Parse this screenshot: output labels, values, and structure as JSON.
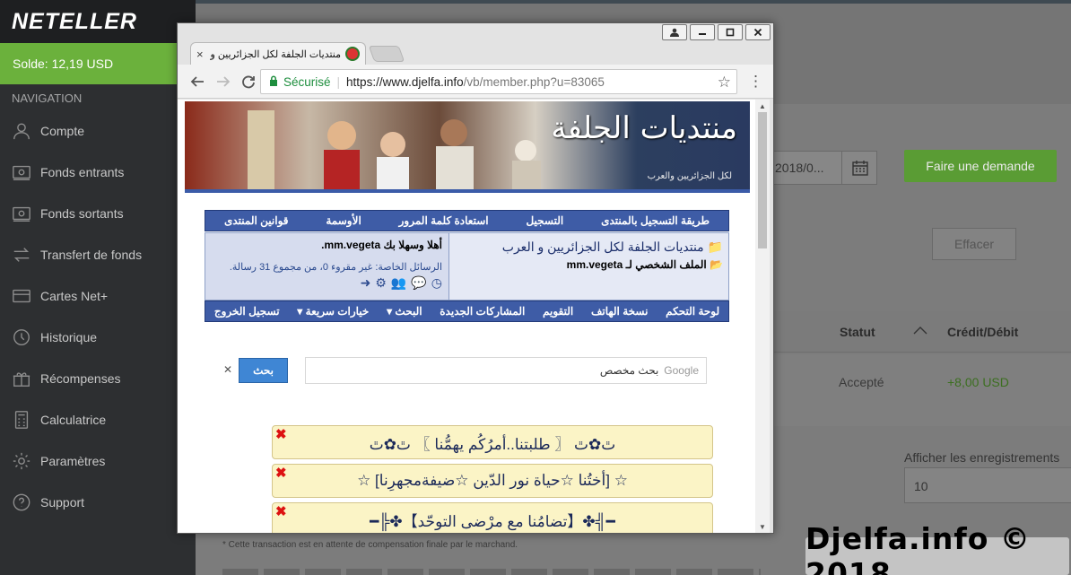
{
  "neteller": {
    "logo": "NETELLER",
    "balance": "Solde: 12,19 USD",
    "nav_title": "NAVIGATION",
    "nav_items": [
      {
        "label": "Compte",
        "icon": "user-icon"
      },
      {
        "label": "Fonds entrants",
        "icon": "money-in-icon"
      },
      {
        "label": "Fonds sortants",
        "icon": "money-out-icon"
      },
      {
        "label": "Transfert de fonds",
        "icon": "transfer-icon"
      },
      {
        "label": "Cartes Net+",
        "icon": "card-icon"
      },
      {
        "label": "Historique",
        "icon": "history-icon"
      },
      {
        "label": "Récompenses",
        "icon": "gift-icon"
      },
      {
        "label": "Calculatrice",
        "icon": "calculator-icon"
      },
      {
        "label": "Paramètres",
        "icon": "gear-icon"
      },
      {
        "label": "Support",
        "icon": "help-icon"
      }
    ],
    "date_value": "2018/0...",
    "request_button": "Faire une demande",
    "clear_button": "Effacer",
    "table": {
      "col_status": "Statut",
      "col_amount": "Crédit/Débit",
      "row_status": "Accepté",
      "row_amount": "+8,00 USD"
    },
    "records_label": "Afficher les enregistrements",
    "records_value": "10",
    "footnote": "* Cette transaction est en attente de compensation finale par le marchand.",
    "watermark": "Djelfa.info © 2018",
    "colors": {
      "sidebar": "#2d2f31",
      "accent_green": "#6bb13c"
    }
  },
  "browser": {
    "tab_title": "منتديات الجلفة لكل الجزائريين و",
    "tab_close": "×",
    "secure_label": "Sécurisé",
    "url_host": "https://www.djelfa.info",
    "url_path": "/vb/member.php?u=83065"
  },
  "forum": {
    "banner_logo": "منتديات الجلفة",
    "banner_sub": "لكل الجزائريين والعرب",
    "nav_top": [
      "طريقة التسجيل بالمنتدى",
      "التسجيل",
      "استعادة كلمة المرور",
      "الأوسمة",
      "قوانين المنتدى"
    ],
    "site_title": "منتديات الجلفة لكل الجزائريين و العرب",
    "profile_title": "الملف الشخصي لـ mm.vegeta",
    "welcome": "أهلا وسهلا بك mm.vegeta.",
    "private_messages": "الرسائل الخاصة: غير مقروء 0، من مجموع 31 رسالة.",
    "nav_bottom": [
      "لوحة التحكم",
      "نسخة الهاتف",
      "التقويم",
      "المشاركات الجديدة",
      "البحث ▾",
      "خيارات سريعة ▾",
      "تسجيل الخروج"
    ],
    "search_placeholder": "بحث مخصص",
    "search_brand": "Google",
    "search_button": "بحث",
    "threads": [
      "ﭢ✿ﭢ 〖 طلبتنا..أمرُكُم يهمُّنا 〗 ﭢ✿ﭢ",
      "☆ [أختُنا ☆حياة نور الدّين ☆ضيفةمجهرِنا] ☆",
      "━╣✤【تضامُنا مع مرْضى التوحّد】✤╠━"
    ]
  }
}
